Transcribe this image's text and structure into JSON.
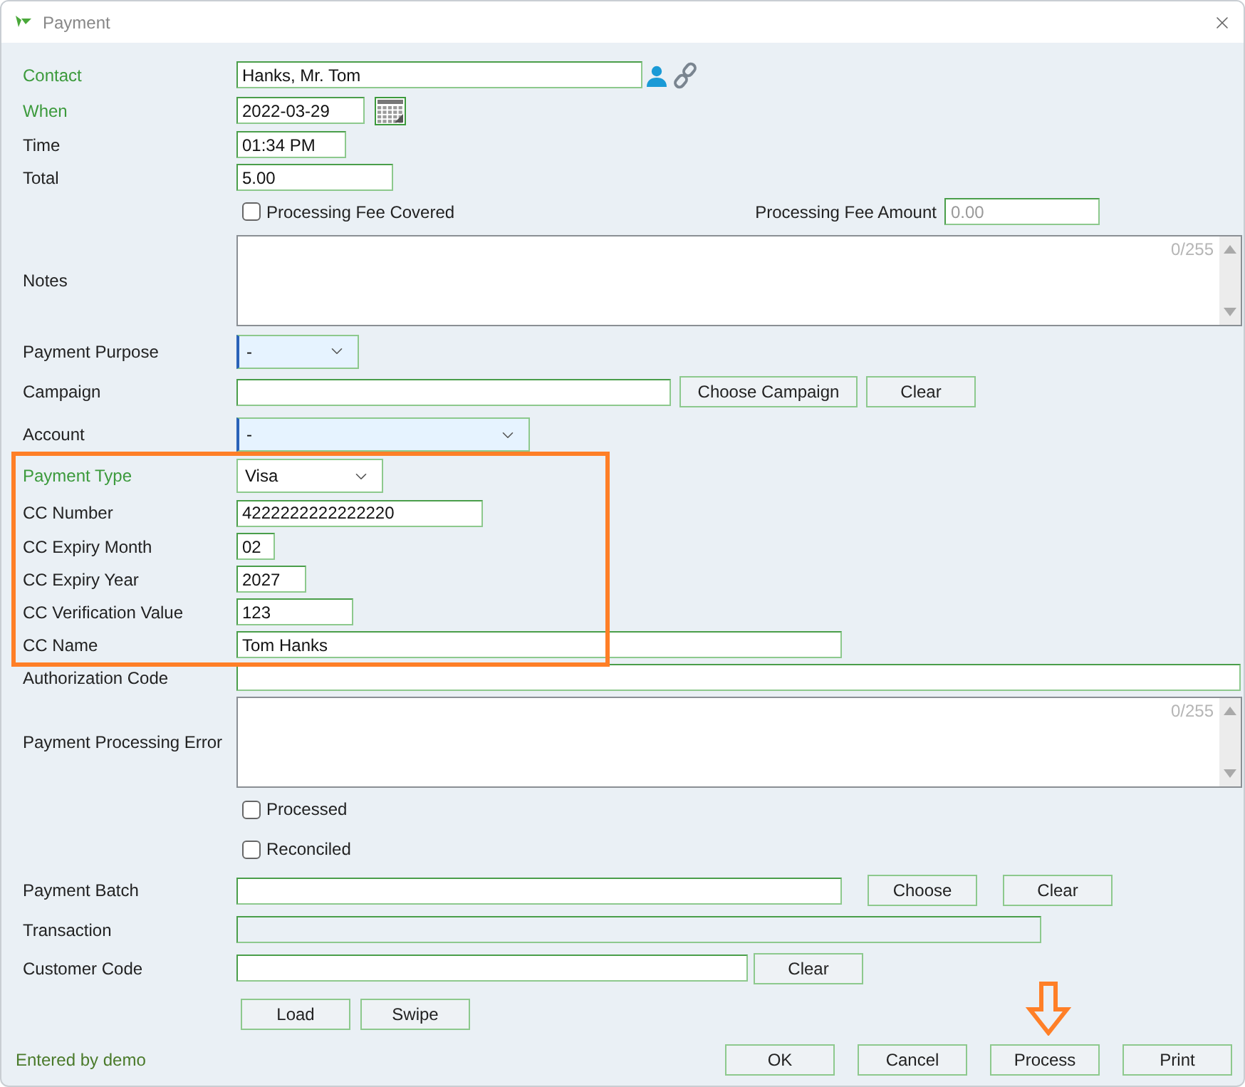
{
  "window": {
    "title": "Payment"
  },
  "rows": [
    {
      "kind": "contact",
      "label": "Contact",
      "required": true,
      "value": "Hanks, Mr. Tom"
    },
    {
      "kind": "date",
      "label": "When",
      "required": true,
      "value": "2022-03-29"
    },
    {
      "kind": "text",
      "label": "Time",
      "required": false,
      "value": "01:34 PM"
    },
    {
      "kind": "text",
      "label": "Total",
      "required": false,
      "value": "5.00"
    },
    {
      "kind": "fee",
      "checkbox": {
        "label": "Processing Fee Covered",
        "checked": false
      },
      "side_label": "Processing Fee Amount",
      "placeholder": "0.00"
    },
    {
      "kind": "textarea",
      "label": "Notes",
      "required": false,
      "counter": "0/255"
    },
    {
      "kind": "select",
      "label": "Payment Purpose",
      "required": false,
      "value": "-",
      "has_value": false
    },
    {
      "kind": "text",
      "label": "Campaign",
      "required": false,
      "value": "",
      "buttons": [
        "Choose Campaign",
        "Clear"
      ]
    },
    {
      "kind": "select",
      "label": "Account",
      "required": false,
      "value": "-",
      "has_value": false
    },
    {
      "kind": "select",
      "label": "Payment Type",
      "required": true,
      "value": "Visa",
      "has_value": true
    },
    {
      "kind": "text",
      "label": "CC Number",
      "required": false,
      "value": "4222222222222220"
    },
    {
      "kind": "text",
      "label": "CC Expiry Month",
      "required": false,
      "value": "02"
    },
    {
      "kind": "text",
      "label": "CC Expiry Year",
      "required": false,
      "value": "2027"
    },
    {
      "kind": "text",
      "label": "CC Verification Value",
      "required": false,
      "value": "123"
    },
    {
      "kind": "text",
      "label": "CC Name",
      "required": false,
      "value": "Tom Hanks"
    },
    {
      "kind": "text",
      "label": "Authorization Code",
      "required": false,
      "value": ""
    },
    {
      "kind": "textarea",
      "label": "Payment Processing Error",
      "required": false,
      "counter": "0/255"
    },
    {
      "kind": "checkbox",
      "checkbox": {
        "label": "Processed",
        "checked": false
      }
    },
    {
      "kind": "checkbox",
      "checkbox": {
        "label": "Reconciled",
        "checked": false
      }
    },
    {
      "kind": "text",
      "label": "Payment Batch",
      "required": false,
      "value": "",
      "buttons": [
        "Choose",
        "Clear"
      ]
    },
    {
      "kind": "text",
      "label": "Transaction",
      "required": false,
      "value": "",
      "disabled": true
    },
    {
      "kind": "text",
      "label": "Customer Code",
      "required": false,
      "value": "",
      "buttons": [
        "Clear"
      ]
    },
    {
      "kind": "buttons",
      "buttons": [
        "Load",
        "Swipe"
      ]
    }
  ],
  "footer": {
    "entered_by": "Entered by demo",
    "buttons": [
      "OK",
      "Cancel",
      "Process",
      "Print"
    ]
  }
}
